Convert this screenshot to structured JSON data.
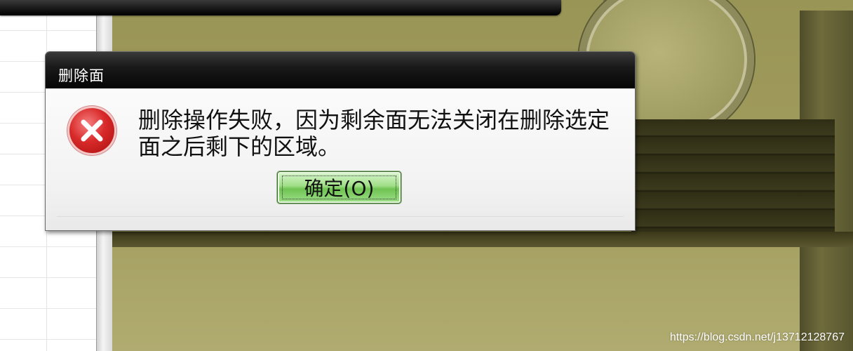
{
  "dialog": {
    "title": "删除面",
    "message": "删除操作失败，因为剩余面无法关闭在删除选定面之后剩下的区域。",
    "ok_button": "确定(O)",
    "icon": "error-icon"
  },
  "background": {
    "watermark": "https://blog.csdn.net/j13712128767"
  },
  "colors": {
    "viewport": "#a29d5e",
    "titlebar": "#1a1a1a",
    "button_green": "#7fcf63",
    "error_red": "#d92a2a"
  }
}
